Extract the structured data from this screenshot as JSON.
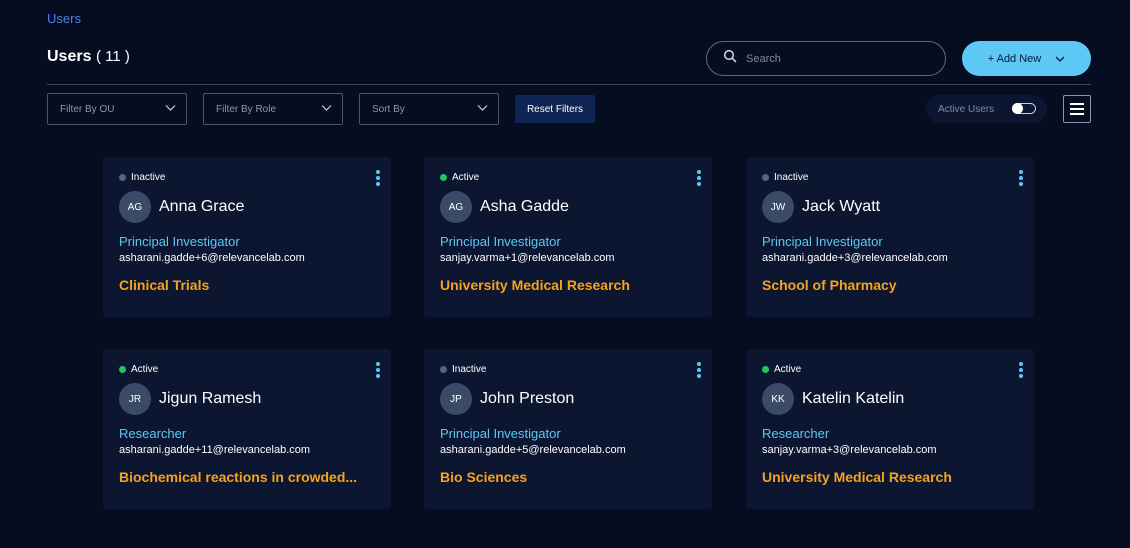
{
  "breadcrumb": "Users",
  "header": {
    "title": "Users",
    "count": "( 11 )"
  },
  "search": {
    "placeholder": "Search",
    "icon": "search-icon"
  },
  "add_new": {
    "label": "+ Add New",
    "icon": "chevron-down-icon"
  },
  "filters": {
    "ou": "Filter By OU",
    "role": "Filter By Role",
    "sort": "Sort By",
    "reset": "Reset Filters"
  },
  "active_users": {
    "label": "Active Users",
    "enabled": false
  },
  "colors": {
    "background": "#070d20",
    "card": "#0c1630",
    "accent": "#5dc8f5",
    "ou_text": "#f5a21c",
    "active_dot": "#22c55e",
    "inactive_dot": "#5a6478"
  },
  "users": [
    {
      "status": "Inactive",
      "initials": "AG",
      "name": "Anna Grace",
      "role": "Principal Investigator",
      "email": "asharani.gadde+6@relevancelab.com",
      "ou": "Clinical Trials"
    },
    {
      "status": "Active",
      "initials": "AG",
      "name": "Asha Gadde",
      "role": "Principal Investigator",
      "email": "sanjay.varma+1@relevancelab.com",
      "ou": "University Medical Research"
    },
    {
      "status": "Inactive",
      "initials": "JW",
      "name": "Jack Wyatt",
      "role": "Principal Investigator",
      "email": "asharani.gadde+3@relevancelab.com",
      "ou": "School of Pharmacy"
    },
    {
      "status": "Active",
      "initials": "JR",
      "name": "Jigun Ramesh",
      "role": "Researcher",
      "email": "asharani.gadde+11@relevancelab.com",
      "ou": "Biochemical reactions in crowded..."
    },
    {
      "status": "Inactive",
      "initials": "JP",
      "name": "John Preston",
      "role": "Principal Investigator",
      "email": "asharani.gadde+5@relevancelab.com",
      "ou": "Bio Sciences"
    },
    {
      "status": "Active",
      "initials": "KK",
      "name": "Katelin Katelin",
      "role": "Researcher",
      "email": "sanjay.varma+3@relevancelab.com",
      "ou": "University Medical Research"
    }
  ]
}
